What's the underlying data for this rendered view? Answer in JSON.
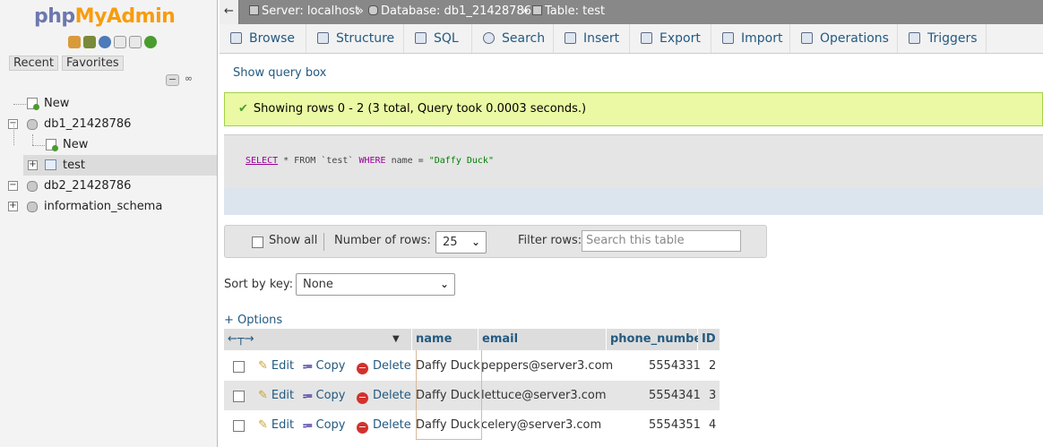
{
  "sidebar": {
    "logo": {
      "php": "php",
      "my": "My",
      "admin": "Admin"
    },
    "tabs": {
      "recent": "Recent",
      "favorites": "Favorites"
    },
    "tree": [
      {
        "label": "New"
      },
      {
        "label": "db1_21428786",
        "expanded": true
      },
      {
        "label": "New"
      },
      {
        "label": "test",
        "selected": true
      },
      {
        "label": "db2_21428786"
      },
      {
        "label": "information_schema"
      }
    ]
  },
  "breadcrumb": {
    "server": "Server: localhost",
    "sep": "»",
    "database": "Database: db1_21428786",
    "table": "Table: test"
  },
  "menu": [
    "Browse",
    "Structure",
    "SQL",
    "Search",
    "Insert",
    "Export",
    "Import",
    "Operations",
    "Triggers"
  ],
  "main": {
    "show_query": "Show query box",
    "success": "Showing rows 0 - 2 (3 total, Query took 0.0003 seconds.)",
    "sql": {
      "select": "SELECT",
      "middle": " * FROM `test` ",
      "where": "WHERE",
      "cond": " name = ",
      "value": "\"Daffy Duck\""
    },
    "nav": {
      "show_all": "Show all",
      "number_of_rows": "Number of rows:",
      "rows_value": "25",
      "filter_rows": "Filter rows:",
      "filter_placeholder": "Search this table"
    },
    "sort_by_key": "Sort by key:",
    "sort_value": "None",
    "options": "+ Options"
  },
  "table": {
    "headers": [
      "name",
      "email",
      "phone_number",
      "ID"
    ],
    "actions": {
      "edit": "Edit",
      "copy": "Copy",
      "delete": "Delete"
    },
    "rows": [
      {
        "name": "Daffy Duck",
        "email": "peppers@server3.com",
        "phone": "5554331",
        "id": "2"
      },
      {
        "name": "Daffy Duck",
        "email": "lettuce@server3.com",
        "phone": "5554341",
        "id": "3"
      },
      {
        "name": "Daffy Duck",
        "email": "celery@server3.com",
        "phone": "5554351",
        "id": "4"
      }
    ]
  },
  "colors": {
    "accent": "#235a81",
    "success_bg": "#ebf8a4",
    "logo_orange": "#f89c0e",
    "logo_blue": "#6c78af"
  }
}
